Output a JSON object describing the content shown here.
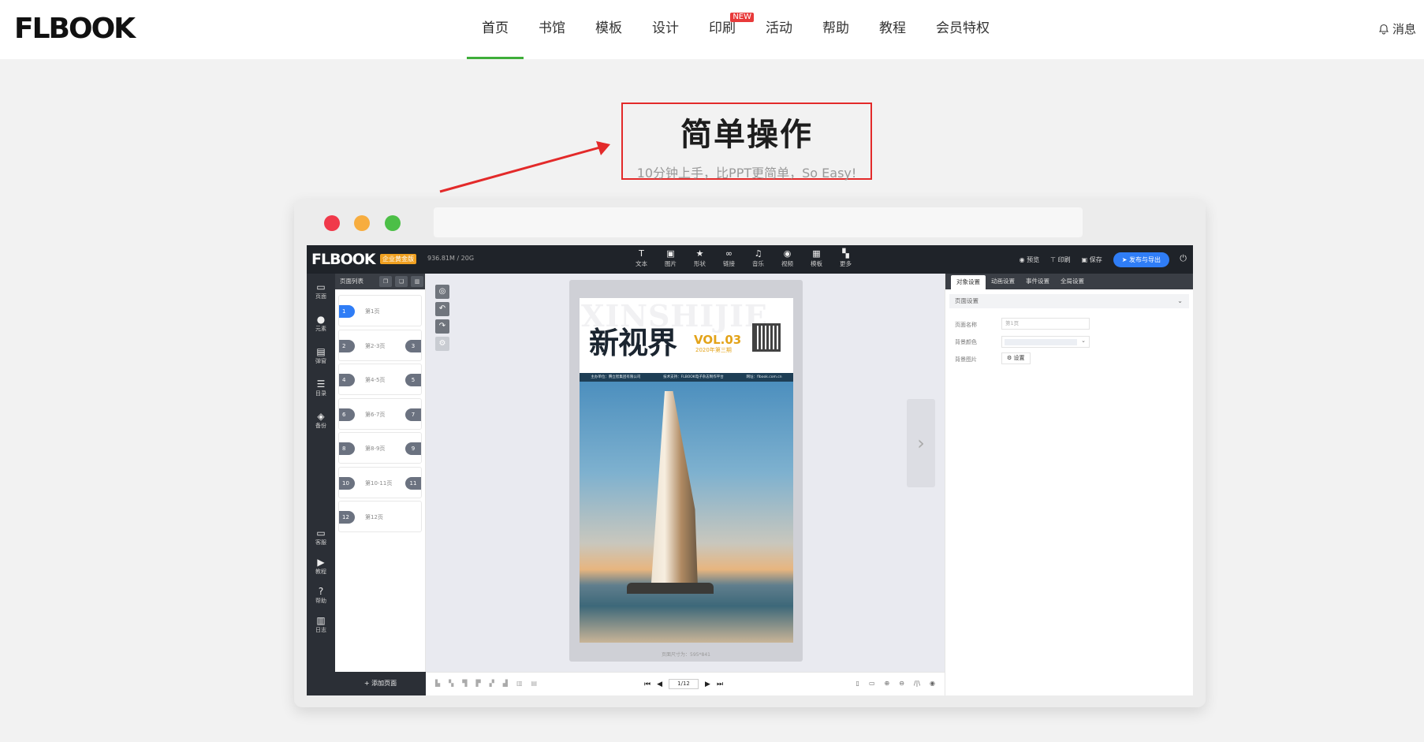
{
  "header": {
    "logo_text": "FLBOOK",
    "nav": [
      {
        "label": "首页",
        "active": true
      },
      {
        "label": "书馆"
      },
      {
        "label": "模板"
      },
      {
        "label": "设计"
      },
      {
        "label": "印刷",
        "badge": "NEW"
      },
      {
        "label": "活动"
      },
      {
        "label": "帮助"
      },
      {
        "label": "教程"
      },
      {
        "label": "会员特权"
      }
    ],
    "messages_label": "消息"
  },
  "hero": {
    "title": "简单操作",
    "subtitle": "10分钟上手，比PPT更简单，So Easy!"
  },
  "browser": {
    "dot_colors": [
      "#f0394a",
      "#f7ad3f",
      "#4cbf47"
    ]
  },
  "editor": {
    "logo_text": "FLBOOK",
    "edition_badge": "企业黄金版",
    "storage": "936.81M / 20G",
    "tools": [
      {
        "label": "文本",
        "icon": "T"
      },
      {
        "label": "图片",
        "icon": "▣"
      },
      {
        "label": "形状",
        "icon": "★"
      },
      {
        "label": "链接",
        "icon": "∞"
      },
      {
        "label": "音乐",
        "icon": "♫"
      },
      {
        "label": "视频",
        "icon": "◉"
      },
      {
        "label": "模板",
        "icon": "▦"
      },
      {
        "label": "更多",
        "icon": "▚"
      }
    ],
    "top_actions": {
      "preview": "预览",
      "print": "印刷",
      "save": "保存",
      "publish": "发布与导出"
    },
    "left_nav": [
      {
        "label": "页面",
        "icon": "▭"
      },
      {
        "label": "元素",
        "icon": "●"
      },
      {
        "label": "弹窗",
        "icon": "▤"
      },
      {
        "label": "目录",
        "icon": "☰"
      },
      {
        "label": "备份",
        "icon": "◈"
      }
    ],
    "left_nav_bottom": [
      {
        "label": "客服",
        "icon": "▭"
      },
      {
        "label": "教程",
        "icon": "▶"
      },
      {
        "label": "帮助",
        "icon": "?"
      },
      {
        "label": "日志",
        "icon": "▥"
      }
    ],
    "page_list": {
      "title": "页面列表",
      "pages": [
        {
          "num": "1",
          "label": "第1页",
          "active": true
        },
        {
          "num": "2",
          "label": "第2-3页",
          "num2": "3"
        },
        {
          "num": "4",
          "label": "第4-5页",
          "num2": "5"
        },
        {
          "num": "6",
          "label": "第6-7页",
          "num2": "7"
        },
        {
          "num": "8",
          "label": "第8-9页",
          "num2": "9"
        },
        {
          "num": "10",
          "label": "第10-11页",
          "num2": "11"
        },
        {
          "num": "12",
          "label": "第12页"
        }
      ],
      "add_page_label": "+ 添加页面"
    },
    "magazine": {
      "bg_text": "XINSHIJIE",
      "title": "新视界",
      "vol": "VOL.03",
      "issue": "2020年第三期",
      "info": [
        "主办单位：腾立智集团有限公司",
        "技术支持：FLBOOK电子杂志制作平台",
        "网址：flbook.com.cn"
      ],
      "page_size_label": "页面尺寸为：595*841"
    },
    "pager": {
      "current": "1/12"
    },
    "props": {
      "tabs": [
        "对象设置",
        "动画设置",
        "事件设置",
        "全局设置"
      ],
      "section_title": "页面设置",
      "page_name_label": "页面名称",
      "page_name_value": "第1页",
      "bg_color_label": "背景颜色",
      "bg_image_label": "背景图片",
      "settings_btn": "⚙ 设置"
    }
  }
}
